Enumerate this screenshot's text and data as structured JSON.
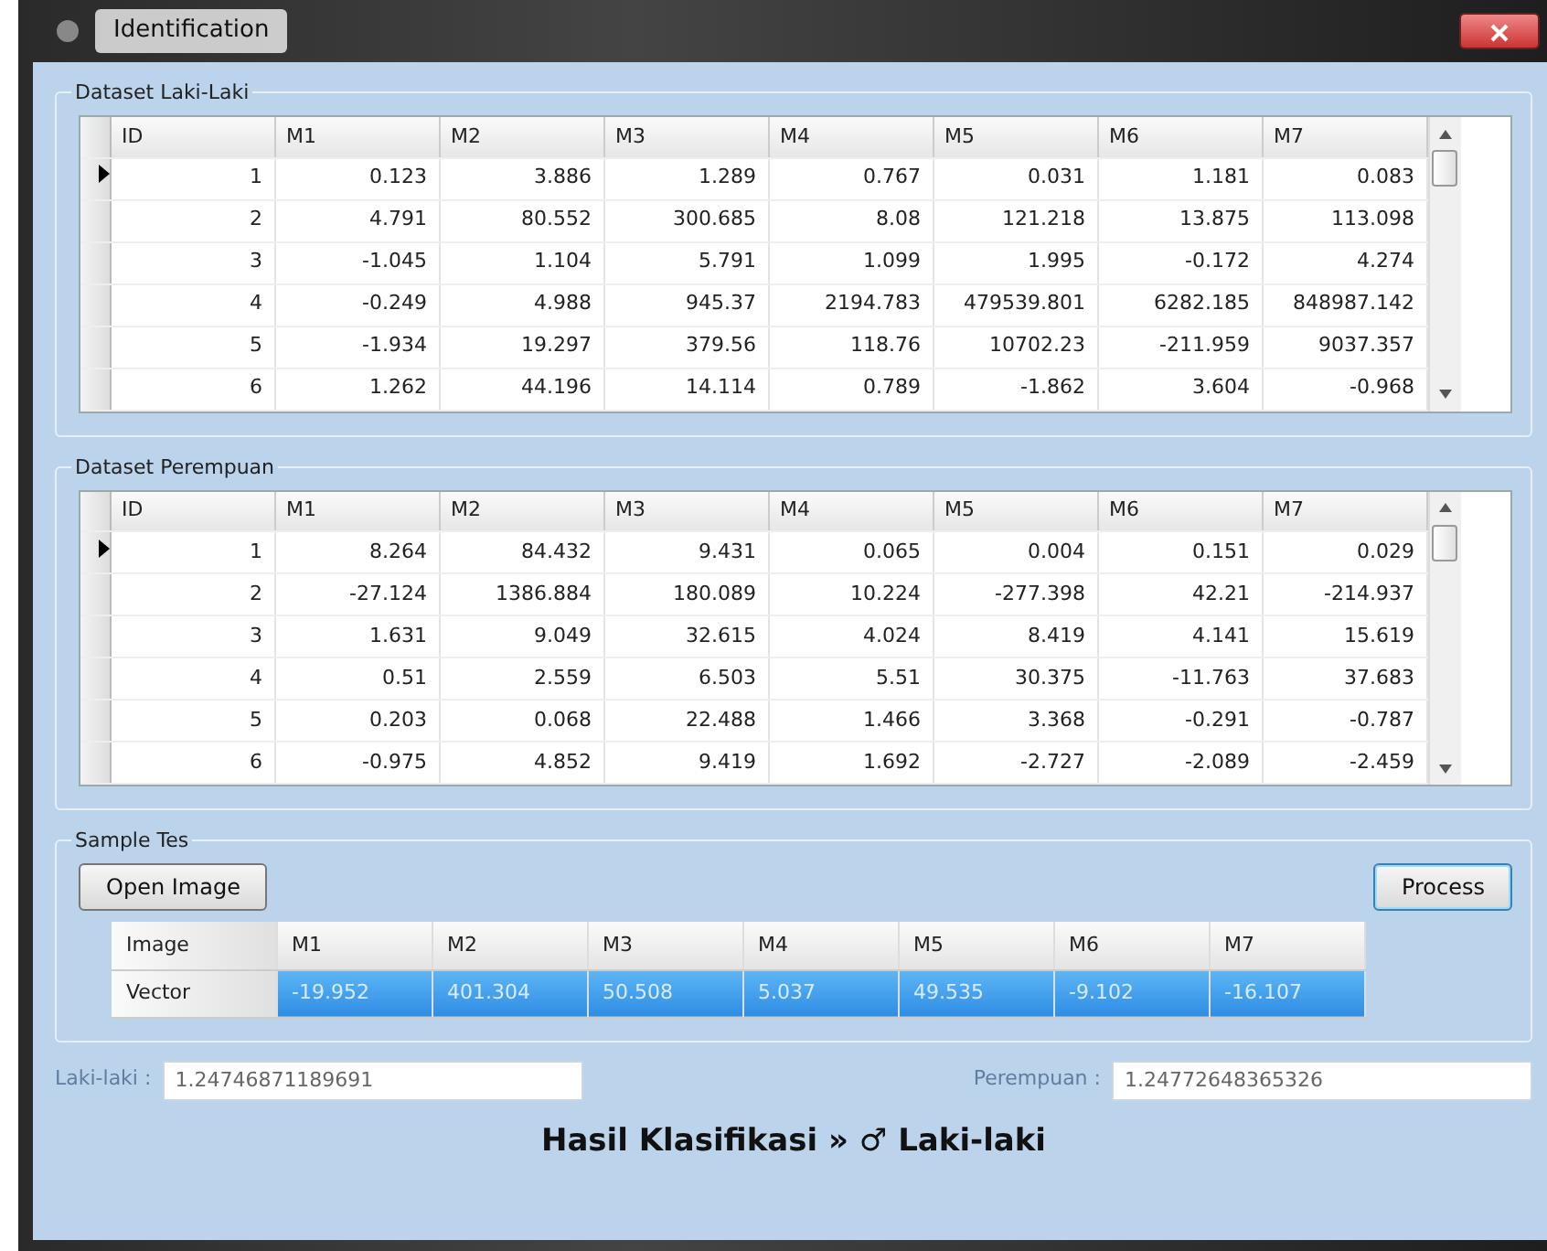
{
  "window": {
    "title": "Identification"
  },
  "datasets": [
    {
      "title": "Dataset Laki-Laki",
      "columns": [
        "ID",
        "M1",
        "M2",
        "M3",
        "M4",
        "M5",
        "M6",
        "M7"
      ],
      "rows": [
        {
          "current": true,
          "cells": [
            "1",
            "0.123",
            "3.886",
            "1.289",
            "0.767",
            "0.031",
            "1.181",
            "0.083"
          ]
        },
        {
          "current": false,
          "cells": [
            "2",
            "4.791",
            "80.552",
            "300.685",
            "8.08",
            "121.218",
            "13.875",
            "113.098"
          ]
        },
        {
          "current": false,
          "cells": [
            "3",
            "-1.045",
            "1.104",
            "5.791",
            "1.099",
            "1.995",
            "-0.172",
            "4.274"
          ]
        },
        {
          "current": false,
          "cells": [
            "4",
            "-0.249",
            "4.988",
            "945.37",
            "2194.783",
            "479539.801",
            "6282.185",
            "848987.142"
          ]
        },
        {
          "current": false,
          "cells": [
            "5",
            "-1.934",
            "19.297",
            "379.56",
            "118.76",
            "10702.23",
            "-211.959",
            "9037.357"
          ]
        },
        {
          "current": false,
          "cells": [
            "6",
            "1.262",
            "44.196",
            "14.114",
            "0.789",
            "-1.862",
            "3.604",
            "-0.968"
          ]
        }
      ]
    },
    {
      "title": "Dataset Perempuan",
      "columns": [
        "ID",
        "M1",
        "M2",
        "M3",
        "M4",
        "M5",
        "M6",
        "M7"
      ],
      "rows": [
        {
          "current": true,
          "cells": [
            "1",
            "8.264",
            "84.432",
            "9.431",
            "0.065",
            "0.004",
            "0.151",
            "0.029"
          ]
        },
        {
          "current": false,
          "cells": [
            "2",
            "-27.124",
            "1386.884",
            "180.089",
            "10.224",
            "-277.398",
            "42.21",
            "-214.937"
          ]
        },
        {
          "current": false,
          "cells": [
            "3",
            "1.631",
            "9.049",
            "32.615",
            "4.024",
            "8.419",
            "4.141",
            "15.619"
          ]
        },
        {
          "current": false,
          "cells": [
            "4",
            "0.51",
            "2.559",
            "6.503",
            "5.51",
            "30.375",
            "-11.763",
            "37.683"
          ]
        },
        {
          "current": false,
          "cells": [
            "5",
            "0.203",
            "0.068",
            "22.488",
            "1.466",
            "3.368",
            "-0.291",
            "-0.787"
          ]
        },
        {
          "current": false,
          "cells": [
            "6",
            "-0.975",
            "4.852",
            "9.419",
            "1.692",
            "-2.727",
            "-2.089",
            "-2.459"
          ]
        }
      ]
    }
  ],
  "sample": {
    "title": "Sample Tes",
    "buttons": [
      {
        "label": "Open Image",
        "focused": false
      },
      {
        "label": "Process",
        "focused": true
      }
    ],
    "columns": [
      "Image",
      "M1",
      "M2",
      "M3",
      "M4",
      "M5",
      "M6",
      "M7"
    ],
    "rows": [
      {
        "selected": true,
        "cells": [
          "Vector",
          "-19.952",
          "401.304",
          "50.508",
          "5.037",
          "49.535",
          "-9.102",
          "-16.107"
        ]
      }
    ]
  },
  "scores": [
    {
      "label": "Laki-laki :",
      "value": "1.24746871189691",
      "disabled": true
    },
    {
      "label": "Perempuan :",
      "value": "1.24772648365326",
      "disabled": true
    }
  ],
  "result": "Hasil Klasifikasi » ♂ Laki-laki"
}
